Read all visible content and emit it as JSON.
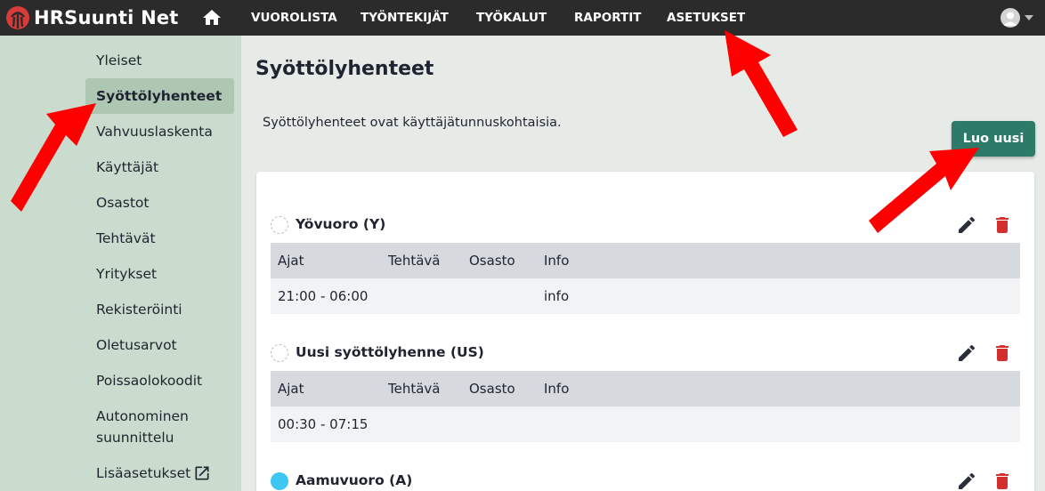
{
  "app": {
    "name": "HRSuunti Net"
  },
  "nav": {
    "items": [
      {
        "id": "vuorolista",
        "label": "VUOROLISTA"
      },
      {
        "id": "tyontekijat",
        "label": "TYÖNTEKIJÄT"
      },
      {
        "id": "tyokalut",
        "label": "TYÖKALUT"
      },
      {
        "id": "raportit",
        "label": "RAPORTIT"
      },
      {
        "id": "asetukset",
        "label": "ASETUKSET"
      }
    ],
    "icons": {
      "home": "home-icon",
      "user": "user-avatar-icon"
    }
  },
  "sidebar": {
    "items": [
      {
        "label": "Yleiset"
      },
      {
        "label": "Syöttölyhenteet",
        "active": true
      },
      {
        "label": "Vahvuuslaskenta"
      },
      {
        "label": "Käyttäjät"
      },
      {
        "label": "Osastot"
      },
      {
        "label": "Tehtävät"
      },
      {
        "label": "Yritykset"
      },
      {
        "label": "Rekisteröinti"
      },
      {
        "label": "Oletusarvot"
      },
      {
        "label": "Poissaolokoodit"
      },
      {
        "label_line1": "Autonominen",
        "label_line2": "suunnittelu"
      },
      {
        "label": "Lisäasetukset",
        "icon": "external-link-icon"
      }
    ]
  },
  "main": {
    "title": "Syöttölyhenteet",
    "intro": "Syöttölyhenteet ovat käyttäjätunnuskohtaisia.",
    "create_button": "Luo uusi",
    "table_headers": {
      "ajat": "Ajat",
      "tehtava": "Tehtävä",
      "osasto": "Osasto",
      "info": "Info"
    },
    "abbreviations": [
      {
        "name": "Yövuoro (Y)",
        "color": "none",
        "row": {
          "ajat": "21:00 - 06:00",
          "tehtava": "",
          "osasto": "",
          "info": "info"
        }
      },
      {
        "name": "Uusi syöttölyhenne (US)",
        "color": "none",
        "row": {
          "ajat": "00:30 - 07:15",
          "tehtava": "",
          "osasto": "",
          "info": ""
        }
      },
      {
        "name": "Aamuvuoro (A)",
        "color": "#3ec6f4"
      }
    ]
  },
  "colors": {
    "topbar": "#2b2b2b",
    "sidebar": "#c9dccd",
    "sidebar_active": "#aec7b3",
    "primary_button": "#2c7a67",
    "delete": "#d32f2f",
    "annotation_arrow": "#ff0000"
  }
}
